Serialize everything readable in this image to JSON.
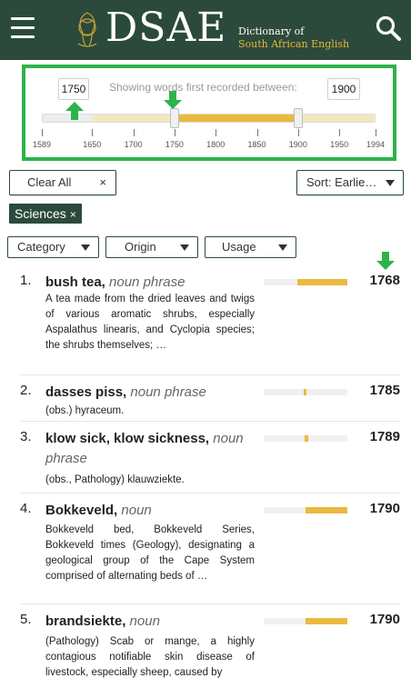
{
  "header": {
    "logo_text": "DSAE",
    "logo_sub_line1": "Dictionary of",
    "logo_sub_line2": "South African English",
    "menu_icon": "hamburger-icon",
    "search_icon": "search-icon",
    "colors": {
      "bar": "#2c4a3b",
      "gold": "#e8b938"
    }
  },
  "timeline": {
    "start_value": "1750",
    "end_value": "1900",
    "caption": "Showing words first recorded between:",
    "axis_min": 1589,
    "axis_max": 1994,
    "range_start": 1750,
    "range_end": 1900,
    "light_range_start": 1650,
    "light_range_end": 1994,
    "ticks": [
      "1589",
      "1650",
      "1700",
      "1750",
      "1800",
      "1850",
      "1900",
      "1950",
      "1994"
    ],
    "accent_color": "#2eb34a"
  },
  "controls": {
    "clear_all_label": "Clear All",
    "clear_all_x": "×",
    "sort_label": "Sort: Earlie…",
    "active_tag": "Sciences",
    "tag_x": "×",
    "filters": [
      "Category",
      "Origin",
      "Usage"
    ]
  },
  "results": [
    {
      "num": "1.",
      "headword": "bush tea,",
      "pos": "noun phrase",
      "definition": "A tea made from the dried leaves and twigs of various aromatic shrubs, especially Aspalathus linearis, and Cyclopia species; the shrubs themselves; …",
      "year": "1768",
      "bar_from": 1750,
      "bar_to": 1994
    },
    {
      "num": "2.",
      "headword": "dasses piss,",
      "pos": "noun phrase",
      "definition": "(obs.) hyraceum.",
      "year": "1785",
      "bar_from": 1784,
      "bar_to": 1792
    },
    {
      "num": "3.",
      "headword": "klow sick, klow sickness,",
      "pos": "noun phrase",
      "definition": "(obs., Pathology) klauwziekte.",
      "year": "1789",
      "bar_from": 1787,
      "bar_to": 1805
    },
    {
      "num": "4.",
      "headword": "Bokkeveld,",
      "pos": "noun",
      "definition": "Bokkeveld bed, Bokkeveld Series, Bokkeveld times (Geology), designating a geological group of the Cape System comprised of alternating beds of …",
      "year": "1790",
      "bar_from": 1790,
      "bar_to": 1994
    },
    {
      "num": "5.",
      "headword": "brandsiekte,",
      "pos": "noun",
      "definition": "(Pathology) Scab or mange, a highly contagious notifiable skin disease of livestock, especially sheep, caused by",
      "year": "1790",
      "bar_from": 1790,
      "bar_to": 1994
    }
  ]
}
